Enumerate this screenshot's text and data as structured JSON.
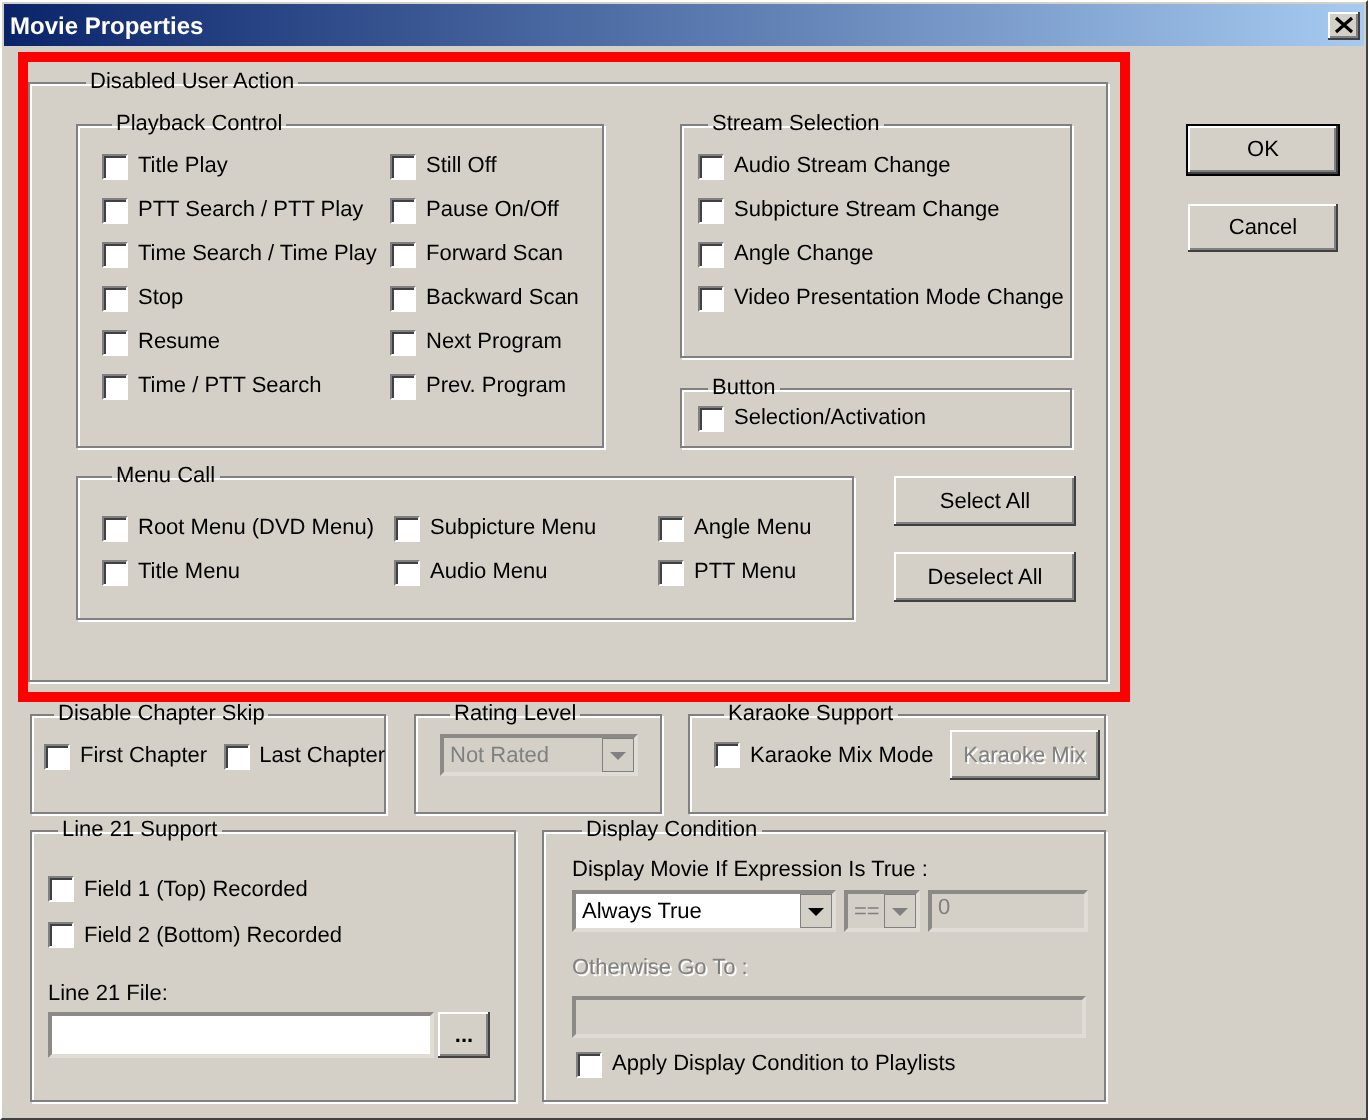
{
  "window": {
    "title": "Movie Properties"
  },
  "disabled_user_action": {
    "label": "Disabled User Action",
    "playback_control": {
      "label": "Playback Control",
      "items": [
        {
          "label": "Title Play",
          "checked": false
        },
        {
          "label": "Still Off",
          "checked": false
        },
        {
          "label": "PTT Search / PTT Play",
          "checked": false
        },
        {
          "label": "Pause On/Off",
          "checked": false
        },
        {
          "label": "Time Search / Time Play",
          "checked": false
        },
        {
          "label": "Forward Scan",
          "checked": false
        },
        {
          "label": "Stop",
          "checked": false
        },
        {
          "label": "Backward Scan",
          "checked": false
        },
        {
          "label": "Resume",
          "checked": false
        },
        {
          "label": "Next Program",
          "checked": false
        },
        {
          "label": "Time / PTT Search",
          "checked": false
        },
        {
          "label": "Prev. Program",
          "checked": false
        }
      ]
    },
    "stream_selection": {
      "label": "Stream Selection",
      "items": [
        {
          "label": "Audio Stream Change",
          "checked": false
        },
        {
          "label": "Subpicture Stream Change",
          "checked": false
        },
        {
          "label": "Angle Change",
          "checked": false
        },
        {
          "label": "Video Presentation Mode Change",
          "checked": false
        }
      ]
    },
    "button": {
      "label": "Button",
      "items": [
        {
          "label": "Selection/Activation",
          "checked": false
        }
      ]
    },
    "menu_call": {
      "label": "Menu Call",
      "items": [
        {
          "label": "Root Menu (DVD Menu)",
          "checked": false
        },
        {
          "label": "Subpicture Menu",
          "checked": false
        },
        {
          "label": "Angle Menu",
          "checked": false
        },
        {
          "label": "Title Menu",
          "checked": false
        },
        {
          "label": "Audio Menu",
          "checked": false
        },
        {
          "label": "PTT Menu",
          "checked": false
        }
      ]
    },
    "buttons": [
      {
        "label": "Select All",
        "disabled": false
      },
      {
        "label": "Deselect All",
        "disabled": false
      }
    ]
  },
  "dialog_buttons": [
    {
      "label": "OK",
      "kind": "default"
    },
    {
      "label": "Cancel",
      "kind": "normal"
    }
  ],
  "disable_chapter_skip": {
    "label": "Disable Chapter Skip",
    "items": [
      {
        "label": "First Chapter",
        "checked": false
      },
      {
        "label": "Last Chapter",
        "checked": false
      }
    ]
  },
  "rating_level": {
    "label": "Rating Level",
    "dropdown": {
      "value": "Not Rated",
      "disabled": true
    }
  },
  "karaoke_support": {
    "label": "Karaoke Support",
    "checkbox": {
      "label": "Karaoke Mix Mode",
      "checked": false
    },
    "button": {
      "label": "Karaoke Mix",
      "disabled": true
    }
  },
  "line21_support": {
    "label": "Line 21 Support",
    "items": [
      {
        "label": "Field 1 (Top) Recorded",
        "checked": false
      },
      {
        "label": "Field 2 (Bottom) Recorded",
        "checked": false
      }
    ],
    "file_label": "Line 21 File:",
    "browse_button": "..."
  },
  "display_condition": {
    "label": "Display Condition",
    "expression_label": "Display Movie If Expression Is True :",
    "condition": {
      "value": "Always True",
      "disabled": false
    },
    "operator": {
      "value": "==",
      "disabled": true
    },
    "operand": {
      "value": "0",
      "disabled": true
    },
    "otherwise_label": {
      "text": "Otherwise Go To :",
      "disabled": true
    },
    "otherwise_field": {
      "disabled": true
    },
    "apply_checkbox": {
      "label": "Apply Display Condition to Playlists",
      "checked": false
    }
  }
}
